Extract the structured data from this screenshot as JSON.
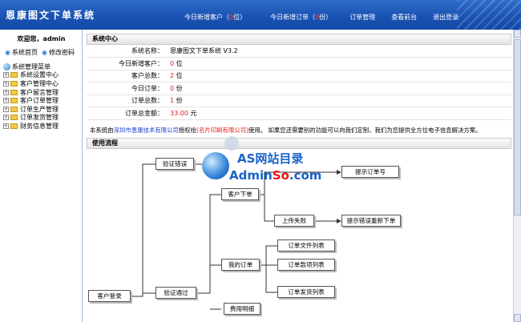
{
  "header": {
    "logo_text": "恩康图文下单系统",
    "nav": [
      {
        "pre": "今日新增客户（",
        "count": "0",
        "post": "位）"
      },
      {
        "pre": "今日新增订单（",
        "count": "0",
        "post": "份）"
      },
      {
        "pre": "订单管理",
        "count": "",
        "post": ""
      },
      {
        "pre": "查看前台",
        "count": "",
        "post": ""
      },
      {
        "pre": "退出登录",
        "count": "",
        "post": ""
      }
    ]
  },
  "sidebar": {
    "welcome": "欢迎您，admin",
    "home_link": "系统首页",
    "password_link": "修改密码",
    "menu_title": "系统管理菜单",
    "items": [
      "系统设置中心",
      "客户管理中心",
      "客户留言管理",
      "客户订单管理",
      "订单生产管理",
      "订单发货管理",
      "财务信息管理"
    ]
  },
  "system_center": {
    "heading": "系统中心",
    "rows": [
      {
        "label": "系统名称：",
        "value": "恩康图文下单系统 V3.2",
        "unit": "",
        "red": false
      },
      {
        "label": "今日新增客户：",
        "value": "0",
        "unit": "位",
        "red": true
      },
      {
        "label": "客户总数：",
        "value": "2",
        "unit": "位",
        "red": true
      },
      {
        "label": "今日订单：",
        "value": "0",
        "unit": "份",
        "red": true
      },
      {
        "label": "订单总数：",
        "value": "1",
        "unit": "份",
        "red": true
      },
      {
        "label": "订单总金额：",
        "value": "33.00",
        "unit": "元",
        "red": true
      }
    ],
    "note": {
      "p1": "本系统由",
      "company": "深圳市恩康技术有限公司",
      "p2": "授权给",
      "licensee": "[名片印刷有限公司]",
      "p3": "使用。 如果您还需要别的功能可以向我们定制，我们为您提供全方位电子信息解决方案。"
    }
  },
  "flow": {
    "heading": "使用流程",
    "nodes": {
      "login": "客户登录",
      "verify_fail": "验证错误",
      "verify_ok": "验证通过",
      "show_order_no": "提示订单号",
      "place_order": "客户下单",
      "upload_fail": "上传失败",
      "show_error_reorder": "提示错误重新下单",
      "my_orders": "我的订单",
      "order_files": "订单文件列表",
      "order_items": "订单款项列表",
      "order_shipping": "订单发货列表",
      "expense_detail": "费用明细"
    }
  },
  "watermark": {
    "line1": "AS网站目录",
    "line2a": "Admin",
    "line2b": "So",
    "line2c": ".com"
  },
  "colors": {
    "header_blue": "#1b53b4",
    "value_red": "#e02020",
    "link_blue": "#1a3fcc"
  }
}
